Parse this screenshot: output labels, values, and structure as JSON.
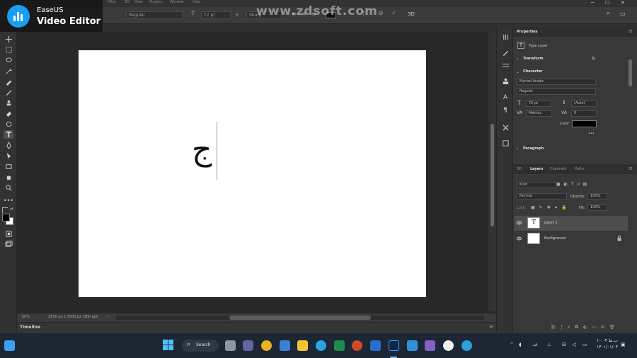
{
  "menubar": {
    "items": [
      "Filter",
      "3D",
      "View",
      "Plugins",
      "Window",
      "Help"
    ]
  },
  "options": {
    "font_style": "Regular",
    "font_size": "72 pt",
    "aa": "Sharp",
    "mode_3d": "3D"
  },
  "watermark": "www.zdsoft.com",
  "easeus": {
    "line1": "EaseUS",
    "line2": "Video Editor"
  },
  "document": {
    "glyph": "ج"
  },
  "status": {
    "zoom": "50%",
    "doc_info": "2550 px x 1500 px (300 ppi)"
  },
  "timeline": {
    "label": "Timeline"
  },
  "properties": {
    "tab": "Properties",
    "layer_type": "Type Layer",
    "transform": "Transform",
    "character": "Character",
    "font_family": "Myriad Arabic",
    "font_style": "Regular",
    "font_size": "72 pt",
    "leading": "(Auto)",
    "kerning": "Metrics",
    "tracking": "0",
    "color_label": "Color",
    "paragraph": "Paragraph",
    "more": "•••"
  },
  "layers_panel": {
    "tabs": [
      "3D",
      "Layers",
      "Channels",
      "Paths"
    ],
    "active_tab": "Layers",
    "kind_label": "Kind",
    "blend_mode": "Normal",
    "opacity_label": "Opacity:",
    "opacity": "100%",
    "lock_label": "Lock:",
    "fill_label": "Fill:",
    "fill": "100%",
    "layers": [
      {
        "name": "Layer 1",
        "thumb": "T"
      },
      {
        "name": "Background"
      }
    ]
  },
  "taskbar": {
    "search_label": "Search",
    "time": "۱۰:۰۴ ب.ظ",
    "date": "۱۴۰۱/۰۱/۰۳"
  },
  "colors": {
    "accent": "#1a9ff0",
    "panel_bg": "#383838",
    "canvas": "#ffffff",
    "taskbar": "#1c2733"
  }
}
